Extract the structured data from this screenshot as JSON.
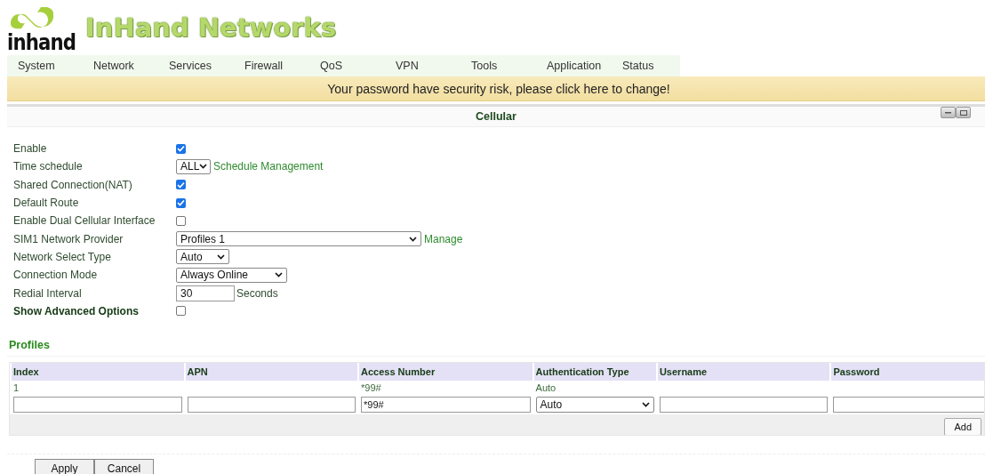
{
  "logo": {
    "wordmark": "inhand",
    "title": "InHand Networks"
  },
  "nav": [
    {
      "label": "System"
    },
    {
      "label": "Network"
    },
    {
      "label": "Services"
    },
    {
      "label": "Firewall"
    },
    {
      "label": "QoS"
    },
    {
      "label": "VPN"
    },
    {
      "label": "Tools"
    },
    {
      "label": "Application"
    },
    {
      "label": "Status"
    }
  ],
  "banner": "Your password have security risk, please click here to change!",
  "panel": {
    "title": "Cellular"
  },
  "fields": [
    {
      "kind": "checkbox",
      "label": "Enable",
      "checked": true
    },
    {
      "kind": "select",
      "label": "Time schedule",
      "value": "ALL",
      "link": "Schedule Management"
    },
    {
      "kind": "checkbox",
      "label": "Shared Connection(NAT)",
      "checked": true
    },
    {
      "kind": "checkbox",
      "label": "Default Route",
      "checked": true
    },
    {
      "kind": "checkbox",
      "label": "Enable Dual Cellular Interface",
      "checked": false
    },
    {
      "kind": "select",
      "label": "SIM1 Network Provider",
      "value": "Profiles 1",
      "link": "Manage"
    },
    {
      "kind": "select",
      "label": "Network Select Type",
      "value": "Auto"
    },
    {
      "kind": "select",
      "label": "Connection Mode",
      "value": "Always Online"
    },
    {
      "kind": "text",
      "label": "Redial Interval",
      "value": "30",
      "unit": "Seconds"
    },
    {
      "kind": "checkbox",
      "label": "Show Advanced Options",
      "checked": false,
      "bold": true
    }
  ],
  "profiles": {
    "title": "Profiles",
    "columns": [
      "Index",
      "APN",
      "Access Number",
      "Authentication Type",
      "Username",
      "Password"
    ],
    "rows": [
      {
        "cells": [
          "1",
          null,
          "*99#",
          "Auto",
          null,
          null
        ]
      }
    ],
    "entry": [
      {
        "kind": "text"
      },
      {
        "kind": "text"
      },
      {
        "kind": "text",
        "value": "*99#"
      },
      {
        "kind": "select",
        "value": "Auto"
      },
      {
        "kind": "text"
      },
      {
        "kind": "text"
      }
    ],
    "add_button": "Add"
  },
  "buttons": [
    "Apply",
    "Cancel"
  ]
}
